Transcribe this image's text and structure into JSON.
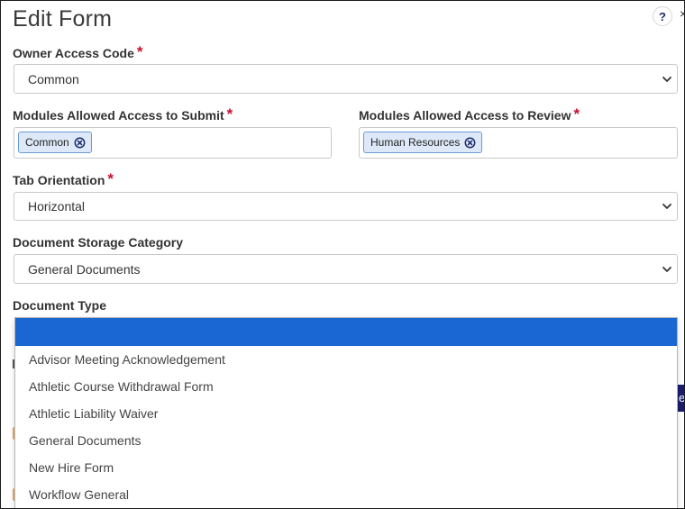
{
  "dialog": {
    "title": "Edit Form",
    "help_label": "?",
    "close_glyph": "×"
  },
  "fields": {
    "owner_access_code": {
      "label": "Owner Access Code",
      "required_mark": "*",
      "value": "Common"
    },
    "modules_submit": {
      "label": "Modules Allowed Access to Submit",
      "required_mark": "*",
      "tags": [
        "Common"
      ]
    },
    "modules_review": {
      "label": "Modules Allowed Access to Review",
      "required_mark": "*",
      "tags": [
        "Human Resources"
      ]
    },
    "tab_orientation": {
      "label": "Tab Orientation",
      "required_mark": "*",
      "value": "Horizontal"
    },
    "document_storage_category": {
      "label": "Document Storage Category",
      "value": "General Documents"
    },
    "document_type": {
      "label": "Document Type",
      "value": "",
      "options": [
        "",
        "Advisor Meeting Acknowledgement",
        "Athletic Course Withdrawal Form",
        "Athletic Liability Waiver",
        "General Documents",
        "New Hire Form",
        "Workflow General"
      ]
    }
  },
  "background": {
    "button_glyph": "e"
  },
  "colors": {
    "required": "#c8102e",
    "highlight": "#1a66d2",
    "tag_bg": "#dde9f8",
    "tag_border": "#6a9ad6",
    "tag_icon": "#1b2b6b"
  },
  "icons": {
    "help": "question-mark-icon",
    "chevron": "chevron-down-icon",
    "tag_remove": "remove-circle-x-icon"
  }
}
